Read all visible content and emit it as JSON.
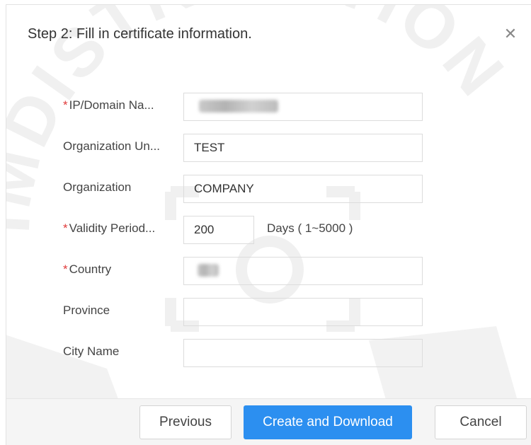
{
  "dialog": {
    "title": "Step 2: Fill in certificate information.",
    "close_icon": "close-icon"
  },
  "form": {
    "ip_domain": {
      "label": "IP/Domain Na...",
      "required": true,
      "value": ""
    },
    "org_unit": {
      "label": "Organization Un...",
      "required": false,
      "value": "TEST"
    },
    "organization": {
      "label": "Organization",
      "required": false,
      "value": "COMPANY"
    },
    "validity": {
      "label": "Validity Period...",
      "required": true,
      "value": "200",
      "unit": "Days ( 1~5000 )"
    },
    "country": {
      "label": "Country",
      "required": true,
      "value": ""
    },
    "province": {
      "label": "Province",
      "required": false,
      "value": ""
    },
    "city": {
      "label": "City Name",
      "required": false,
      "value": ""
    }
  },
  "footer": {
    "previous_label": "Previous",
    "create_label": "Create and Download",
    "cancel_label": "Cancel"
  },
  "colors": {
    "primary": "#2c8ff0",
    "required": "#e03a3a"
  }
}
